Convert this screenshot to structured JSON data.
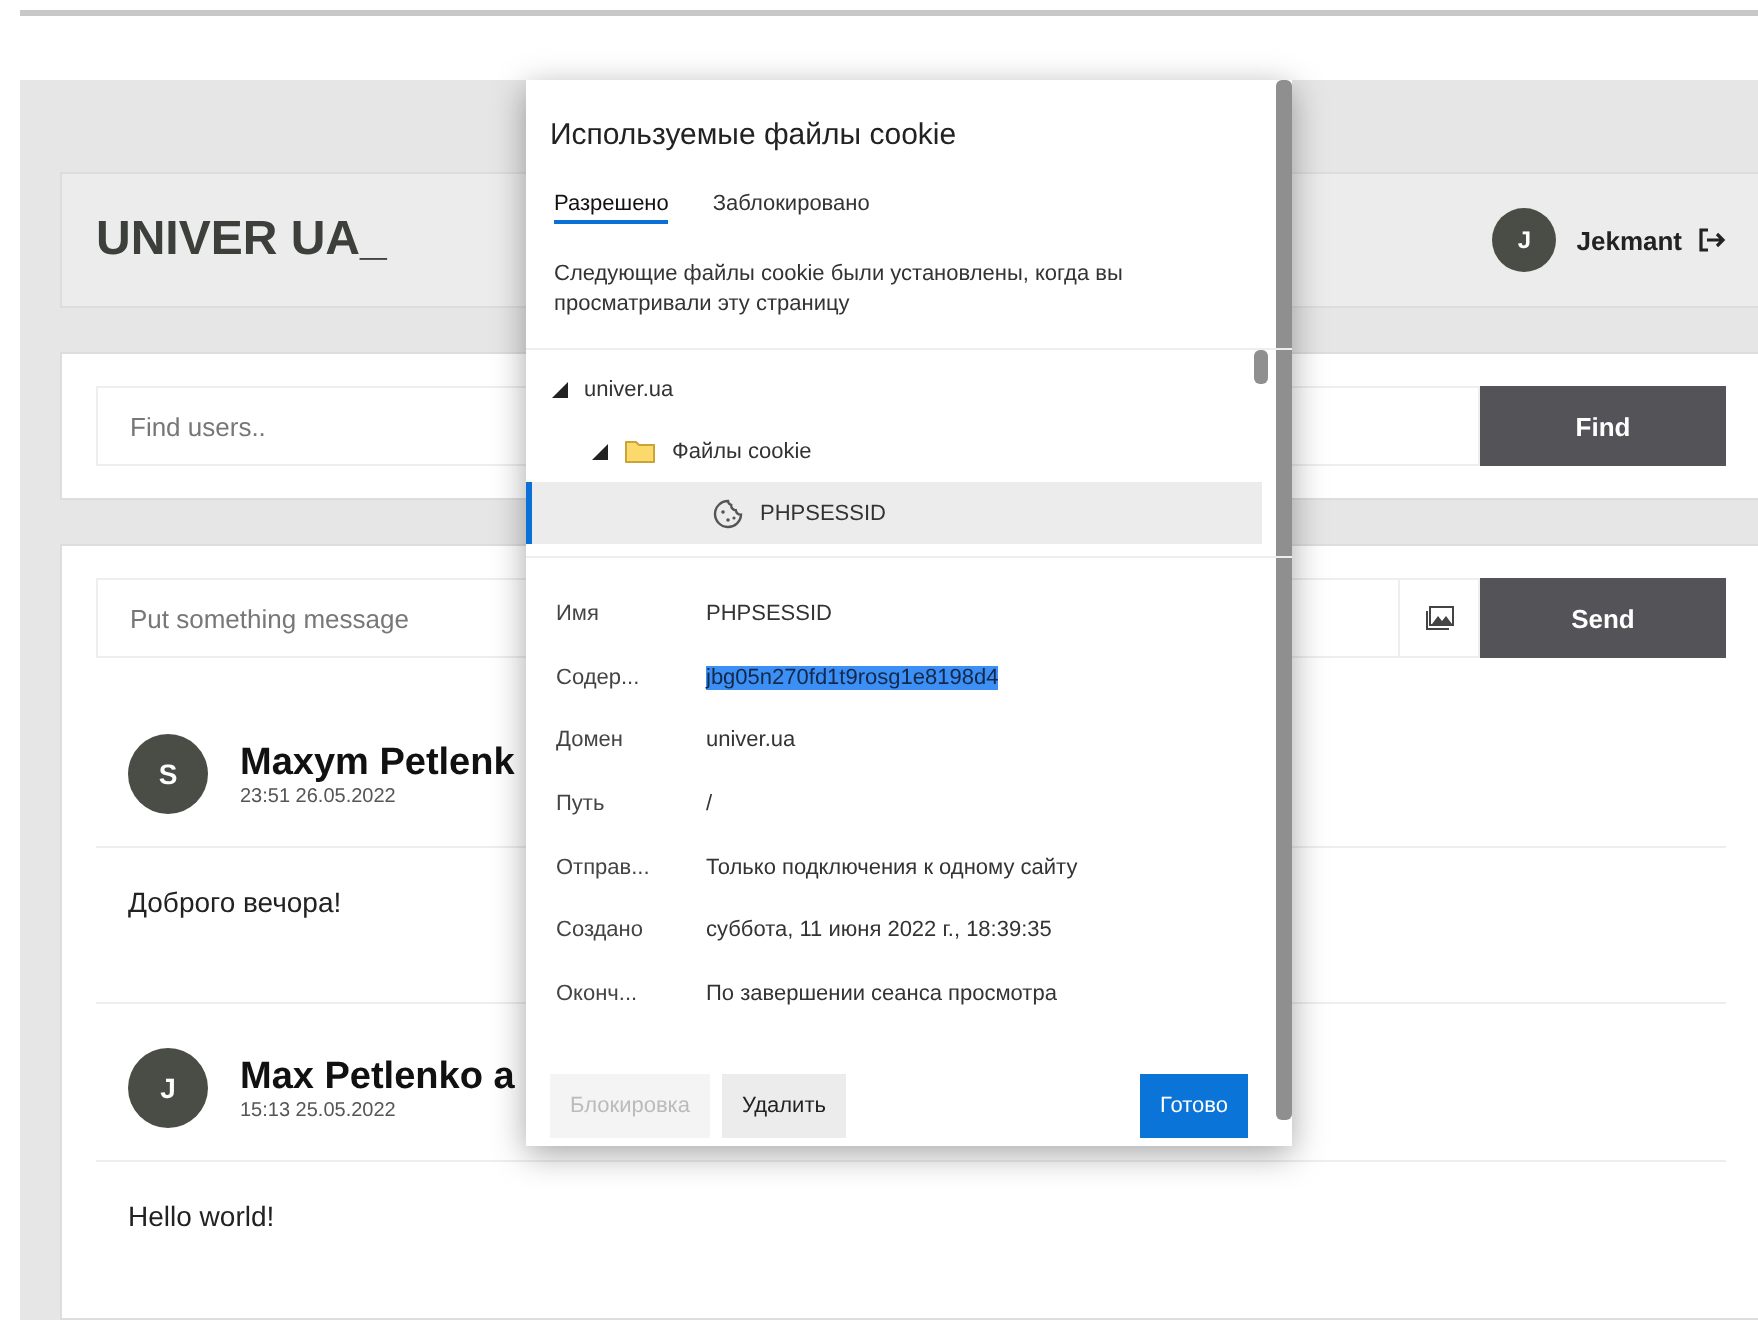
{
  "header": {
    "logo": "UNIVER UA_",
    "user_initial": "J",
    "user_name": "Jekmant"
  },
  "search": {
    "placeholder": "Find users..",
    "button": "Find"
  },
  "composer": {
    "placeholder": "Put something message",
    "button": "Send"
  },
  "messages": [
    {
      "initial": "S",
      "author": "Maxym Petlenk",
      "time": "23:51 26.05.2022",
      "text": "Доброго вечора!"
    },
    {
      "initial": "J",
      "author": "Max Petlenko a",
      "time": "15:13 25.05.2022",
      "text": "Hello world!"
    }
  ],
  "cookie_dialog": {
    "title": "Используемые файлы cookie",
    "tabs": [
      {
        "label": "Разрешено",
        "selected": true
      },
      {
        "label": "Заблокировано",
        "selected": false
      }
    ],
    "description": "Следующие файлы cookie были установлены, когда вы просматривали эту страницу",
    "tree": [
      {
        "label": "univer.ua",
        "kind": "site",
        "expanded": true,
        "selected": false,
        "children": [
          {
            "label": "Файлы cookie",
            "kind": "folder",
            "expanded": true,
            "selected": false,
            "children": [
              {
                "label": "PHPSESSID",
                "kind": "cookie",
                "selected": true
              }
            ]
          }
        ]
      }
    ],
    "details": [
      {
        "label": "Имя",
        "value": "PHPSESSID",
        "highlighted": false
      },
      {
        "label": "Содер...",
        "value": "jbg05n270fd1t9rosg1e8198d4",
        "highlighted": true
      },
      {
        "label": "Домен",
        "value": "univer.ua",
        "highlighted": false
      },
      {
        "label": "Путь",
        "value": "/",
        "highlighted": false
      },
      {
        "label": "Отправ...",
        "value": "Только подключения к одному сайту",
        "highlighted": false
      },
      {
        "label": "Создано",
        "value": "суббота, 11 июня 2022 г., 18:39:35",
        "highlighted": false
      },
      {
        "label": "Оконч...",
        "value": "По завершении сеанса просмотра",
        "highlighted": false
      }
    ],
    "buttons": [
      {
        "label": "Блокировка",
        "kind": "secondary",
        "disabled": true
      },
      {
        "label": "Удалить",
        "kind": "secondary",
        "disabled": false
      },
      {
        "label": "Готово",
        "kind": "primary",
        "disabled": false
      }
    ]
  }
}
